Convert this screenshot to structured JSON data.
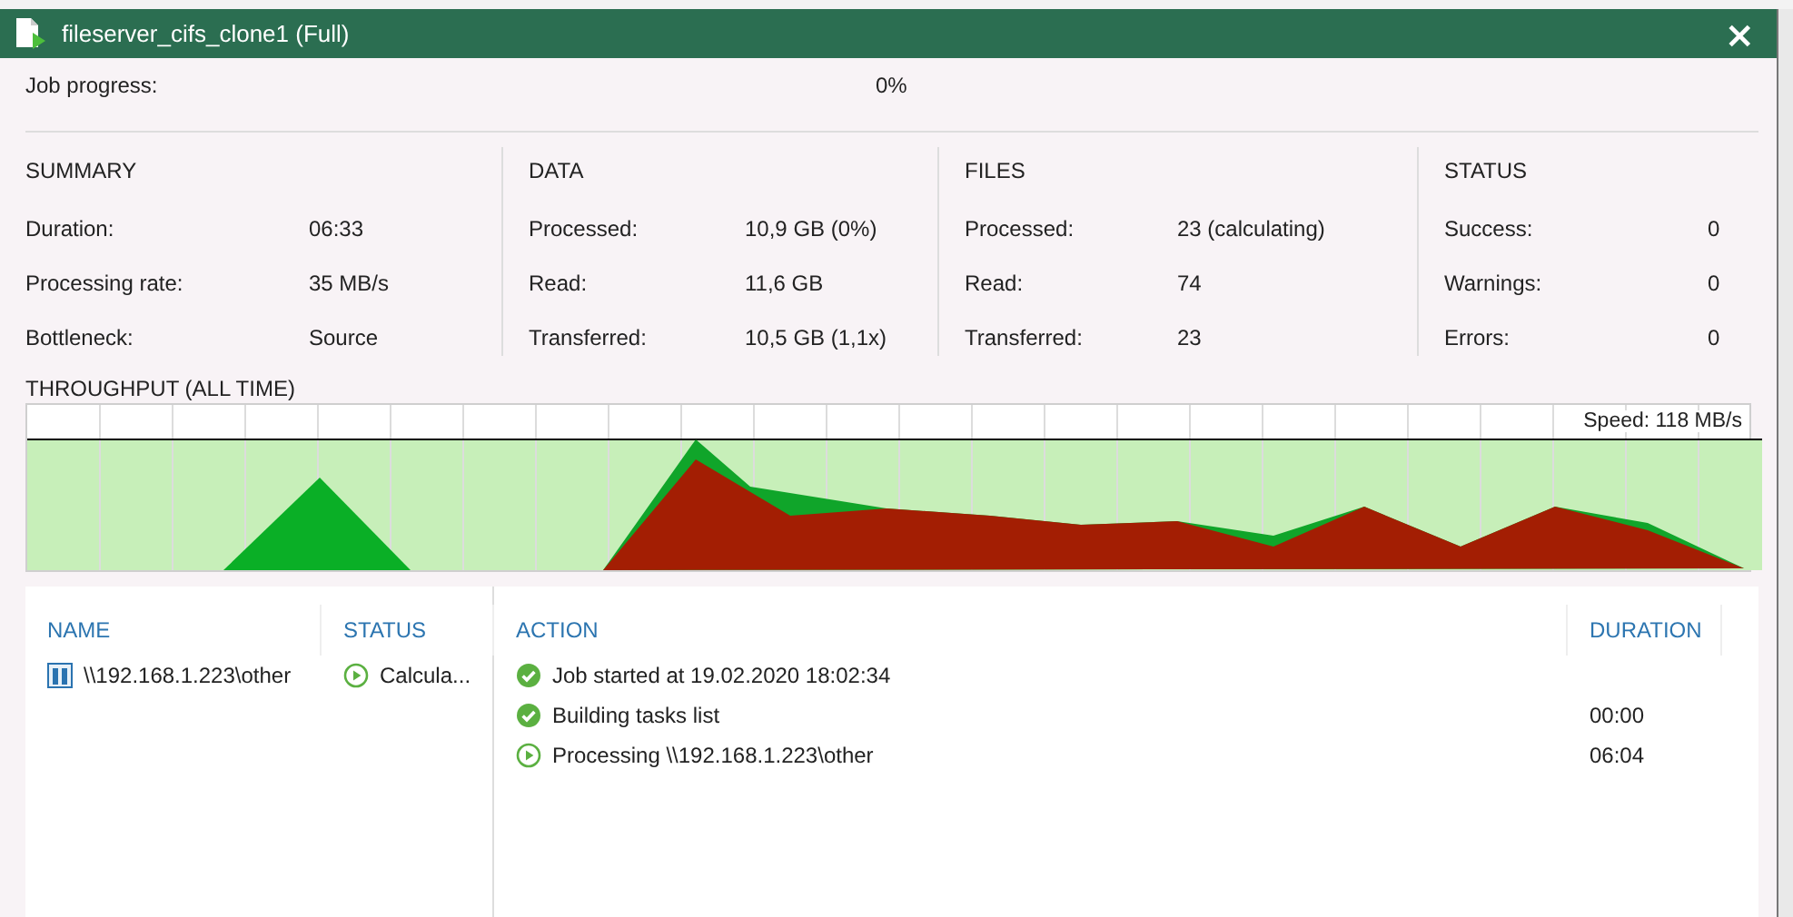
{
  "window": {
    "title": "fileserver_cifs_clone1 (Full)",
    "close": "×"
  },
  "job_progress": {
    "label": "Job progress:",
    "value": "0%"
  },
  "sections": [
    {
      "title": "SUMMARY",
      "rows": [
        {
          "label": "Duration:",
          "value": "06:33"
        },
        {
          "label": "Processing rate:",
          "value": "35 MB/s"
        },
        {
          "label": "Bottleneck:",
          "value": "Source"
        }
      ]
    },
    {
      "title": "DATA",
      "rows": [
        {
          "label": "Processed:",
          "value": "10,9 GB (0%)"
        },
        {
          "label": "Read:",
          "value": "11,6 GB"
        },
        {
          "label": "Transferred:",
          "value": "10,5 GB (1,1x)"
        }
      ]
    },
    {
      "title": "FILES",
      "rows": [
        {
          "label": "Processed:",
          "value": "23 (calculating)"
        },
        {
          "label": "Read:",
          "value": "74"
        },
        {
          "label": "Transferred:",
          "value": "23"
        }
      ]
    },
    {
      "title": "STATUS",
      "rows": [
        {
          "label": "Success:",
          "value": "0"
        },
        {
          "label": "Warnings:",
          "value": "0"
        },
        {
          "label": "Errors:",
          "value": "0"
        }
      ]
    }
  ],
  "throughput": {
    "title": "THROUGHPUT (ALL TIME)",
    "speed": "Speed: 118 MB/s"
  },
  "tasks": {
    "columns": [
      "NAME",
      "STATUS"
    ],
    "rows": [
      {
        "name": "\\\\192.168.1.223\\other",
        "status": "Calcula...",
        "kind": "running"
      }
    ]
  },
  "actions": {
    "columns": [
      "ACTION",
      "DURATION"
    ],
    "rows": [
      {
        "text": "Job started at 19.02.2020 18:02:34",
        "kind": "success"
      },
      {
        "text": "Building tasks list",
        "duration": "00:00",
        "kind": "success"
      },
      {
        "text": "Processing \\\\192.168.1.223\\other",
        "duration": "06:04",
        "kind": "running"
      }
    ]
  }
}
